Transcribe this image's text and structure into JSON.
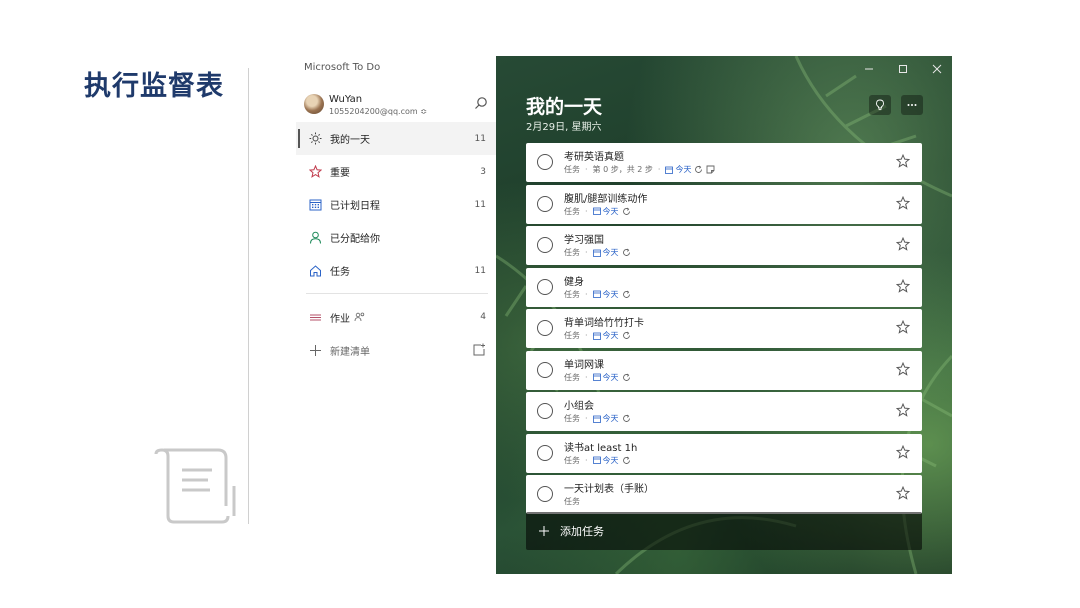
{
  "slide": {
    "title": "执行监督表"
  },
  "app": {
    "title": "Microsoft To Do",
    "account": {
      "name": "WuYan",
      "email": "1055204200@qq.com ≎"
    },
    "nav": [
      {
        "label": "我的一天",
        "count": "11",
        "icon": "sun-icon"
      },
      {
        "label": "重要",
        "count": "3",
        "icon": "star-icon"
      },
      {
        "label": "已计划日程",
        "count": "11",
        "icon": "calendar-icon"
      },
      {
        "label": "已分配给你",
        "count": "",
        "icon": "person-icon"
      },
      {
        "label": "任务",
        "count": "11",
        "icon": "home-icon"
      }
    ],
    "list": {
      "label": "作业",
      "count": "4",
      "icon": "list-lines-icon"
    },
    "new_list": {
      "label": "新建清单",
      "icon": "plus-icon"
    }
  },
  "main": {
    "title": "我的一天",
    "date": "2月29日, 星期六",
    "add_task_label": "添加任务",
    "tasks": [
      {
        "title": "考研英语真题",
        "category": "任务",
        "steps": "第 0 步，共 2 步",
        "due": "今天",
        "repeat": true,
        "note": true
      },
      {
        "title": "腹肌/腿部训练动作",
        "category": "任务",
        "due": "今天",
        "repeat": true
      },
      {
        "title": "学习强国",
        "category": "任务",
        "due": "今天",
        "repeat": true
      },
      {
        "title": "健身",
        "category": "任务",
        "due": "今天",
        "repeat": true
      },
      {
        "title": "背单词给竹竹打卡",
        "category": "任务",
        "due": "今天",
        "repeat": true
      },
      {
        "title": "单词网课",
        "category": "任务",
        "due": "今天",
        "repeat": true
      },
      {
        "title": "小组会",
        "category": "任务",
        "due": "今天",
        "repeat": true
      },
      {
        "title": "读书at least 1h",
        "category": "任务",
        "due": "今天",
        "repeat": true
      },
      {
        "title": "一天计划表（手账）",
        "category": "任务"
      }
    ]
  },
  "colors": {
    "slide_title": "#1f3a6b",
    "due_link": "#2b63c7",
    "sidebar_bg": "#ffffff",
    "task_card": "#ffffff"
  }
}
